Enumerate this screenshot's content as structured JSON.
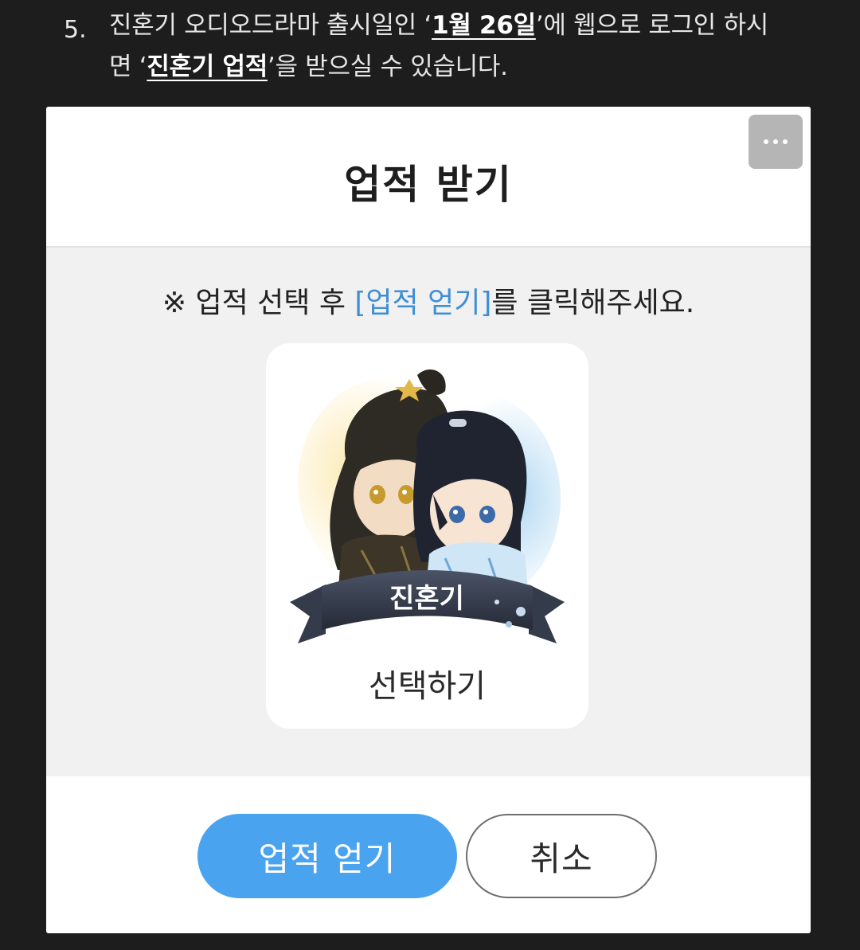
{
  "instruction": {
    "number": "5.",
    "line1_a": "진혼기 오디오드라마 출시일인 ‘",
    "line1_highlight": "1월 26일",
    "line1_b": "’에 웹으로 로그인 하시",
    "line2_a": "면 ‘",
    "line2_highlight": "진혼기 업적",
    "line2_b": "’을 받으실 수 있습니다."
  },
  "dialog": {
    "title": "업적 받기",
    "notice_prefix": "※ 업적 선택 후 ",
    "notice_link": "[업적 얻기]",
    "notice_suffix": "를 클릭해주세요.",
    "achievement": {
      "banner_text": "진혼기",
      "select_label": "선택하기"
    },
    "buttons": {
      "confirm": "업적 얻기",
      "cancel": "취소"
    }
  },
  "colors": {
    "page_background": "#1d1d1d",
    "accent_blue": "#4aa3ef",
    "link_blue": "#3d8fd6",
    "body_gray": "#f1f1f1"
  },
  "icons": {
    "more": "more-horizontal-icon"
  }
}
